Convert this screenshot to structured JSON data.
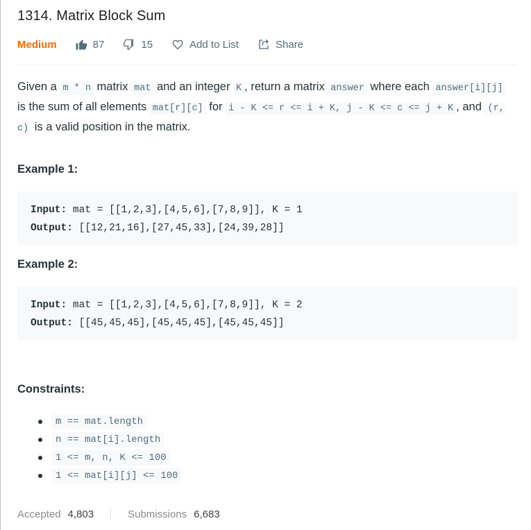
{
  "problem": {
    "title": "1314. Matrix Block Sum",
    "difficulty": "Medium",
    "likes": "87",
    "dislikes": "15",
    "add_to_list": "Add to List",
    "share": "Share"
  },
  "description": {
    "t1": "Given a ",
    "c1": "m * n",
    "t2": " matrix ",
    "c2": "mat",
    "t3": " and an integer ",
    "c3": "K",
    "t4": ", return a matrix ",
    "c4": "answer",
    "t5": " where each ",
    "c5": "answer[i][j]",
    "t6": " is the sum of all elements ",
    "c6": "mat[r][c]",
    "t7": " for ",
    "c7": "i - K <= r <= i + K, j - K <= c <= j + K",
    "t8": ", and ",
    "c8": "(r, c)",
    "t9": " is a valid position in the matrix."
  },
  "examples": [
    {
      "heading": "Example 1:",
      "input_label": "Input:",
      "input_value": " mat = [[1,2,3],[4,5,6],[7,8,9]], K = 1",
      "output_label": "Output:",
      "output_value": " [[12,21,16],[27,45,33],[24,39,28]]"
    },
    {
      "heading": "Example 2:",
      "input_label": "Input:",
      "input_value": " mat = [[1,2,3],[4,5,6],[7,8,9]], K = 2",
      "output_label": "Output:",
      "output_value": " [[45,45,45],[45,45,45],[45,45,45]]"
    }
  ],
  "constraints": {
    "heading": "Constraints:",
    "items": [
      "m == mat.length",
      "n == mat[i].length",
      "1 <= m, n, K <= 100",
      "1 <= mat[i][j] <= 100"
    ]
  },
  "stats": {
    "accepted_label": "Accepted",
    "accepted_value": "4,803",
    "submissions_label": "Submissions",
    "submissions_value": "6,683"
  },
  "colors": {
    "difficulty_medium": "#ef6c00",
    "code_bg": "#f7f9fa",
    "text": "#263238"
  }
}
